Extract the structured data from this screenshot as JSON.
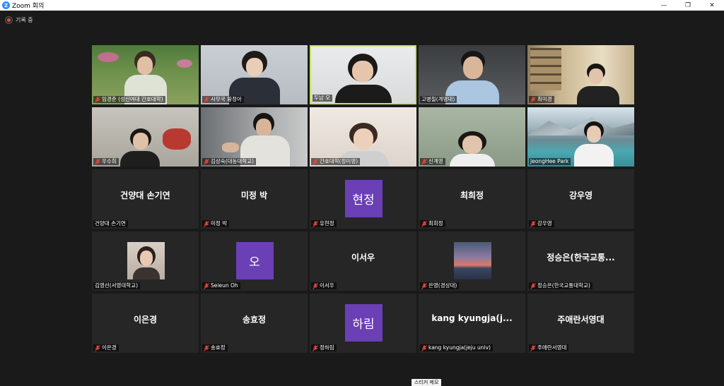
{
  "window": {
    "title": "Zoom 회의",
    "logo": "Z"
  },
  "recording": {
    "label": "기록 중"
  },
  "sticker": {
    "label": "스티커 메모"
  },
  "colors": {
    "active_border": "#c6e060",
    "tile_bg": "#262626",
    "mute_red": "#e8443a",
    "avatar_purple": "#6b3fb5"
  },
  "participants": [
    {
      "name": "임경춘 (성신여대 간호대학)",
      "muted": true
    },
    {
      "name": "사무국 황정아",
      "muted": true
    },
    {
      "name": "두남 오",
      "muted": false,
      "active": true
    },
    {
      "name": "고병철(계명대)",
      "muted": false
    },
    {
      "name": "최미경",
      "muted": true
    },
    {
      "name": "우수희",
      "muted": true
    },
    {
      "name": "김상숙(대동대학교)",
      "muted": true
    },
    {
      "name": "간호대학(정미영)",
      "muted": true
    },
    {
      "name": "신계영",
      "muted": true
    },
    {
      "name": "JeongHee Park",
      "muted": true
    },
    {
      "name": "건양대 손기연",
      "display": "건양대 손기연",
      "muted": false
    },
    {
      "name": "미정 박",
      "display": "미정 박",
      "muted": true
    },
    {
      "name": "유현정",
      "avatar": "현정",
      "muted": true
    },
    {
      "name": "최희정",
      "display": "최희정",
      "muted": true
    },
    {
      "name": "강우영",
      "display": "강우영",
      "muted": true
    },
    {
      "name": "김영선(서영대학교)",
      "muted": false,
      "photo": "portrait"
    },
    {
      "name": "Seieun Oh",
      "avatar": "오",
      "muted": true
    },
    {
      "name": "이서우",
      "display": "이서우",
      "muted": true
    },
    {
      "name": "은영(경상대)",
      "muted": true,
      "photo": "sunset"
    },
    {
      "name": "정승은(한국교통대학교)",
      "display": "정승은(한국교통...",
      "muted": true
    },
    {
      "name": "이은경",
      "display": "이은경",
      "muted": true
    },
    {
      "name": "송효정",
      "display": "송효정",
      "muted": true
    },
    {
      "name": "정하림",
      "avatar": "하림",
      "muted": true
    },
    {
      "name": "kang kyungja(jeju univ)",
      "display": "kang  kyungja(j...",
      "muted": true
    },
    {
      "name": "주애란서영대",
      "display": "주애란서영대",
      "muted": true
    }
  ]
}
